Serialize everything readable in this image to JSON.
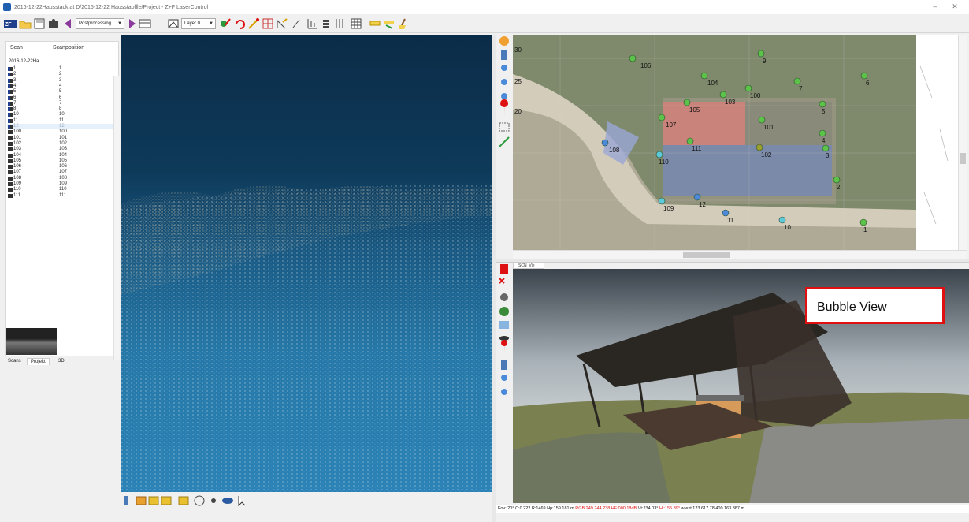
{
  "window": {
    "title": "2016-12-22Hausstack at D/2016-12-22 Hausstaoflle/Project - Z+F LaserControl",
    "minimize": "–",
    "close": "✕"
  },
  "toolbar": {
    "combo_processing": "Postprocessing",
    "combo_layer": "Layer 0",
    "icons": [
      "zf-logo-icon",
      "folder-open-icon",
      "save-icon",
      "puzzle-icon",
      "back-arrow-icon",
      "forward-arrow-icon",
      "table-icon",
      "layer-icon",
      "paint-icon",
      "undo-icon",
      "measure-icon",
      "grid-icon",
      "slope-icon",
      "line-icon",
      "chart-icon",
      "stack-icon",
      "grid-table-icon",
      "highlighter-icon",
      "broom-icon"
    ]
  },
  "scanlist": {
    "col_scan": "Scan",
    "col_position": "Scanposition",
    "group": "2016-12-22Ha...",
    "rows": [
      {
        "scan": "1",
        "pos": "1",
        "type": "scan"
      },
      {
        "scan": "2",
        "pos": "2",
        "type": "scan"
      },
      {
        "scan": "3",
        "pos": "3",
        "type": "scan"
      },
      {
        "scan": "4",
        "pos": "4",
        "type": "scan"
      },
      {
        "scan": "5",
        "pos": "5",
        "type": "scan"
      },
      {
        "scan": "6",
        "pos": "6",
        "type": "scan"
      },
      {
        "scan": "7",
        "pos": "7",
        "type": "scan"
      },
      {
        "scan": "8",
        "pos": "8",
        "type": "scan"
      },
      {
        "scan": "10",
        "pos": "10",
        "type": "scan"
      },
      {
        "scan": "11",
        "pos": "11",
        "type": "scan"
      },
      {
        "scan": "12",
        "pos": "12",
        "type": "scan",
        "selected": true
      },
      {
        "scan": "100",
        "pos": "100",
        "type": "target"
      },
      {
        "scan": "101",
        "pos": "101",
        "type": "target"
      },
      {
        "scan": "102",
        "pos": "102",
        "type": "target"
      },
      {
        "scan": "103",
        "pos": "103",
        "type": "target"
      },
      {
        "scan": "104",
        "pos": "104",
        "type": "target"
      },
      {
        "scan": "105",
        "pos": "105",
        "type": "target"
      },
      {
        "scan": "106",
        "pos": "106",
        "type": "target"
      },
      {
        "scan": "107",
        "pos": "107",
        "type": "target"
      },
      {
        "scan": "108",
        "pos": "108",
        "type": "target"
      },
      {
        "scan": "109",
        "pos": "109",
        "type": "target"
      },
      {
        "scan": "110",
        "pos": "110",
        "type": "target"
      },
      {
        "scan": "111",
        "pos": "111",
        "type": "target"
      }
    ]
  },
  "panel_tabs": [
    "Scans",
    "Projekt",
    "3D"
  ],
  "map": {
    "axis_labels": [
      "30",
      "25",
      "20"
    ],
    "points": [
      {
        "id": "106",
        "color": "#5cc24a"
      },
      {
        "id": "9",
        "color": "#5cc24a"
      },
      {
        "id": "104",
        "color": "#5cc24a"
      },
      {
        "id": "103",
        "color": "#5cc24a"
      },
      {
        "id": "100",
        "color": "#5cc24a"
      },
      {
        "id": "7",
        "color": "#5cc24a"
      },
      {
        "id": "6",
        "color": "#5cc24a"
      },
      {
        "id": "105",
        "color": "#5cc24a"
      },
      {
        "id": "101",
        "color": "#5cc24a"
      },
      {
        "id": "5",
        "color": "#5cc24a"
      },
      {
        "id": "107",
        "color": "#5cc24a"
      },
      {
        "id": "4",
        "color": "#5cc24a"
      },
      {
        "id": "108",
        "color": "#4a8ad8"
      },
      {
        "id": "111",
        "color": "#5cc24a"
      },
      {
        "id": "102",
        "color": "#9aa030"
      },
      {
        "id": "3",
        "color": "#5cc24a"
      },
      {
        "id": "110",
        "color": "#5cc8d8"
      },
      {
        "id": "2",
        "color": "#5cc24a"
      },
      {
        "id": "12",
        "color": "#4a8ad8"
      },
      {
        "id": "109",
        "color": "#5cc8d8"
      },
      {
        "id": "11",
        "color": "#4a8ad8"
      },
      {
        "id": "10",
        "color": "#5cc8d8"
      },
      {
        "id": "1",
        "color": "#5cc24a"
      }
    ]
  },
  "bubble": {
    "tab": "SCN_Vie",
    "callout": "Bubble View"
  },
  "status": {
    "part1": "Fov: 20° C:0.222  R:1469  Hp:159.181 m",
    "part_red": "RGB:249 244 238 HF:000 18dB",
    "part2": "Vt:234.03°",
    "part_red2": "Ht:155.39°",
    "part3": "w-ext:123.617 78.400 163.887 m"
  }
}
